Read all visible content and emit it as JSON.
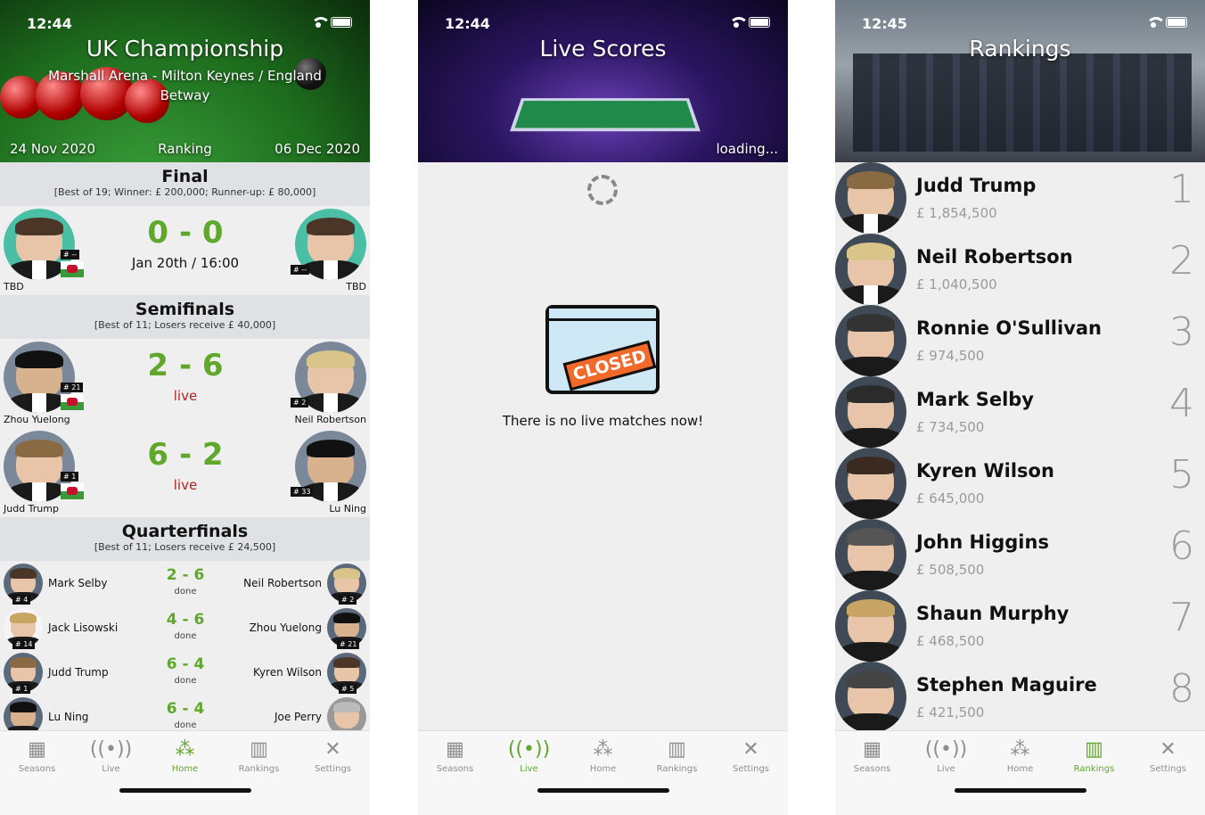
{
  "tabs": [
    {
      "label": "Seasons",
      "icon": "calendar-icon"
    },
    {
      "label": "Live",
      "icon": "broadcast-icon"
    },
    {
      "label": "Home",
      "icon": "snooker-balls-icon"
    },
    {
      "label": "Rankings",
      "icon": "podium-icon"
    },
    {
      "label": "Settings",
      "icon": "tools-icon"
    }
  ],
  "screen1": {
    "time": "12:44",
    "title": "UK Championship",
    "venue": "Marshall Arena - Milton Keynes / England",
    "sponsor": "Betway",
    "start_date": "24 Nov 2020",
    "type": "Ranking",
    "end_date": "06 Dec 2020",
    "final": {
      "title": "Final",
      "info": "[Best of 19; Winner: £ 200,000; Runner-up: £ 80,000]",
      "score_a": "0",
      "score_b": "0",
      "dash": "-",
      "status": "Jan 20th / 16:00",
      "player_a": "TBD",
      "player_b": "TBD",
      "rank_a": "# --",
      "rank_b": "# --"
    },
    "semis": {
      "title": "Semifinals",
      "info": "[Best of 11; Losers receive £ 40,000]",
      "matches": [
        {
          "a": "Zhou Yuelong",
          "ra": "# 21",
          "sa": "2",
          "sb": "6",
          "b": "Neil Robertson",
          "rb": "# 2",
          "status": "live"
        },
        {
          "a": "Judd Trump",
          "ra": "# 1",
          "sa": "6",
          "sb": "2",
          "b": "Lu Ning",
          "rb": "# 33",
          "status": "live"
        }
      ]
    },
    "quarters": {
      "title": "Quarterfinals",
      "info": "[Best of 11; Losers receive £ 24,500]",
      "matches": [
        {
          "a": "Mark Selby",
          "ra": "# 4",
          "sa": "2",
          "sb": "6",
          "b": "Neil Robertson",
          "rb": "# 2",
          "status": "done"
        },
        {
          "a": "Jack Lisowski",
          "ra": "# 14",
          "sa": "4",
          "sb": "6",
          "b": "Zhou Yuelong",
          "rb": "# 21",
          "status": "done"
        },
        {
          "a": "Judd Trump",
          "ra": "# 1",
          "sa": "6",
          "sb": "4",
          "b": "Kyren Wilson",
          "rb": "# 5",
          "status": "done"
        },
        {
          "a": "Lu Ning",
          "ra": "",
          "sa": "6",
          "sb": "4",
          "b": "Joe Perry",
          "rb": "",
          "status": "done"
        }
      ]
    }
  },
  "screen2": {
    "time": "12:44",
    "title": "Live Scores",
    "loading": "loading...",
    "closed_sign": "CLOSED",
    "empty_message": "There is no live matches now!"
  },
  "screen3": {
    "time": "12:45",
    "title": "Rankings",
    "players": [
      {
        "name": "Judd Trump",
        "prize": "£ 1,854,500",
        "pos": "1"
      },
      {
        "name": "Neil Robertson",
        "prize": "£ 1,040,500",
        "pos": "2"
      },
      {
        "name": "Ronnie O'Sullivan",
        "prize": "£ 974,500",
        "pos": "3"
      },
      {
        "name": "Mark Selby",
        "prize": "£ 734,500",
        "pos": "4"
      },
      {
        "name": "Kyren Wilson",
        "prize": "£ 645,000",
        "pos": "5"
      },
      {
        "name": "John Higgins",
        "prize": "£ 508,500",
        "pos": "6"
      },
      {
        "name": "Shaun Murphy",
        "prize": "£ 468,500",
        "pos": "7"
      },
      {
        "name": "Stephen Maguire",
        "prize": "£ 421,500",
        "pos": "8"
      }
    ]
  },
  "colors": {
    "accent": "#5fa82c",
    "live": "#b22222",
    "header_bar": "#dfe1e4"
  }
}
